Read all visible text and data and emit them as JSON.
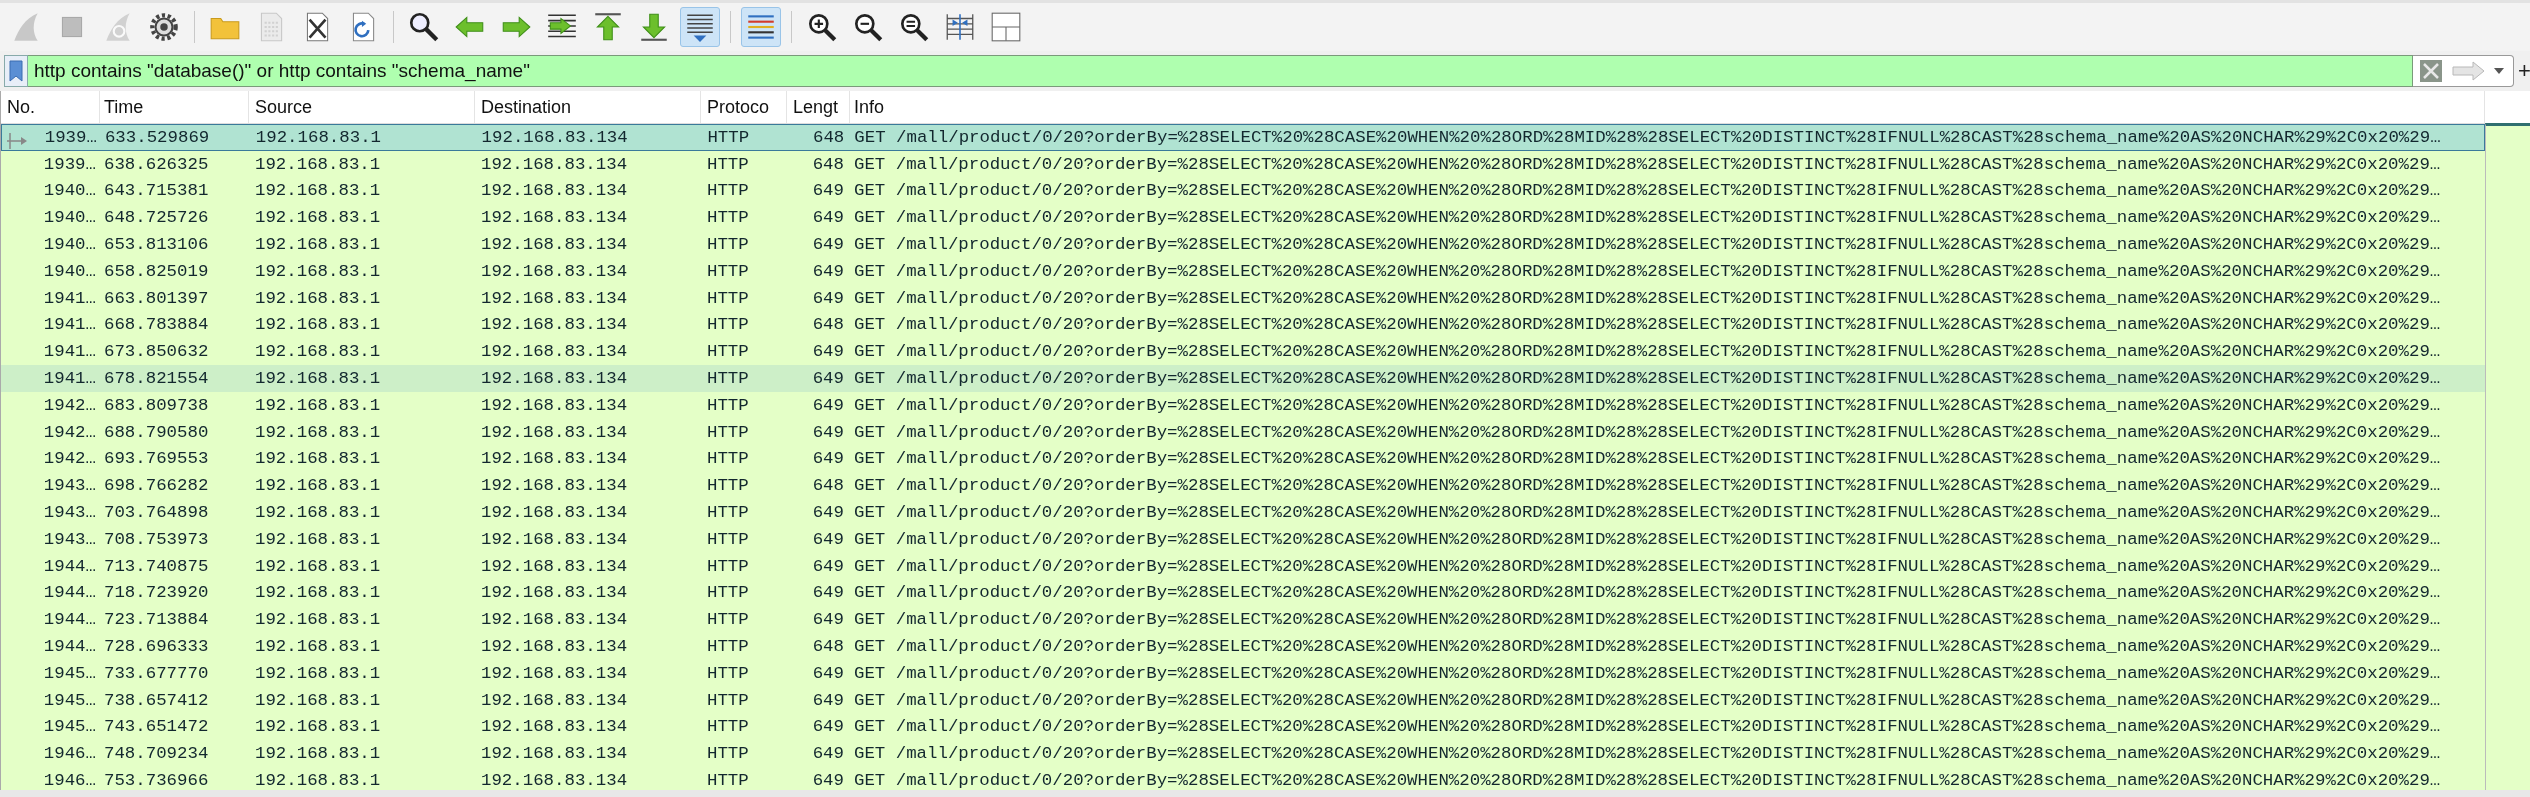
{
  "toolbar": [
    {
      "kind": "start",
      "disabled": true,
      "pressed": false
    },
    {
      "kind": "stop",
      "disabled": true,
      "pressed": false
    },
    {
      "kind": "restart",
      "disabled": true,
      "pressed": false
    },
    {
      "kind": "options",
      "disabled": false,
      "pressed": false
    },
    {
      "kind": "separator"
    },
    {
      "kind": "open",
      "disabled": false,
      "pressed": false
    },
    {
      "kind": "save",
      "disabled": true,
      "pressed": false
    },
    {
      "kind": "close",
      "disabled": false,
      "pressed": false
    },
    {
      "kind": "reload",
      "disabled": false,
      "pressed": false
    },
    {
      "kind": "separator"
    },
    {
      "kind": "find",
      "disabled": false,
      "pressed": false
    },
    {
      "kind": "back",
      "disabled": false,
      "pressed": false
    },
    {
      "kind": "forward",
      "disabled": false,
      "pressed": false
    },
    {
      "kind": "goto",
      "disabled": false,
      "pressed": false
    },
    {
      "kind": "first",
      "disabled": false,
      "pressed": false
    },
    {
      "kind": "last",
      "disabled": false,
      "pressed": false
    },
    {
      "kind": "autoscroll",
      "disabled": false,
      "pressed": true
    },
    {
      "kind": "separator"
    },
    {
      "kind": "colorize",
      "disabled": false,
      "pressed": true
    },
    {
      "kind": "separator"
    },
    {
      "kind": "zoomin",
      "disabled": false,
      "pressed": false
    },
    {
      "kind": "zoomout",
      "disabled": false,
      "pressed": false
    },
    {
      "kind": "zoomreset",
      "disabled": false,
      "pressed": false
    },
    {
      "kind": "resize",
      "disabled": false,
      "pressed": false
    },
    {
      "kind": "layout",
      "disabled": false,
      "pressed": false
    }
  ],
  "filter": {
    "value": "http contains \"database()\" or http contains \"schema_name\"",
    "add_label": "+"
  },
  "table": {
    "columns": [
      "No.",
      "Time",
      "Source",
      "Destination",
      "Protoco",
      "Lengt",
      "Info"
    ],
    "rows": [
      {
        "no": "1939…",
        "time": "633.529869",
        "source": "192.168.83.1",
        "destination": "192.168.83.134",
        "protocol": "HTTP",
        "length": "648",
        "info": "GET /mall/product/0/20?orderBy=%28SELECT%20%28CASE%20WHEN%20%28ORD%28MID%28%28SELECT%20DISTINCT%28IFNULL%28CAST%28schema_name%20AS%20NCHAR%29%2C0x20%29…",
        "selected": true,
        "hovered": false,
        "related": true
      },
      {
        "no": "1939…",
        "time": "638.626325",
        "source": "192.168.83.1",
        "destination": "192.168.83.134",
        "protocol": "HTTP",
        "length": "648",
        "info": "GET /mall/product/0/20?orderBy=%28SELECT%20%28CASE%20WHEN%20%28ORD%28MID%28%28SELECT%20DISTINCT%28IFNULL%28CAST%28schema_name%20AS%20NCHAR%29%2C0x20%29…",
        "selected": false,
        "hovered": false,
        "related": false
      },
      {
        "no": "1940…",
        "time": "643.715381",
        "source": "192.168.83.1",
        "destination": "192.168.83.134",
        "protocol": "HTTP",
        "length": "649",
        "info": "GET /mall/product/0/20?orderBy=%28SELECT%20%28CASE%20WHEN%20%28ORD%28MID%28%28SELECT%20DISTINCT%28IFNULL%28CAST%28schema_name%20AS%20NCHAR%29%2C0x20%29…",
        "selected": false,
        "hovered": false,
        "related": false
      },
      {
        "no": "1940…",
        "time": "648.725726",
        "source": "192.168.83.1",
        "destination": "192.168.83.134",
        "protocol": "HTTP",
        "length": "649",
        "info": "GET /mall/product/0/20?orderBy=%28SELECT%20%28CASE%20WHEN%20%28ORD%28MID%28%28SELECT%20DISTINCT%28IFNULL%28CAST%28schema_name%20AS%20NCHAR%29%2C0x20%29…",
        "selected": false,
        "hovered": false,
        "related": false
      },
      {
        "no": "1940…",
        "time": "653.813106",
        "source": "192.168.83.1",
        "destination": "192.168.83.134",
        "protocol": "HTTP",
        "length": "649",
        "info": "GET /mall/product/0/20?orderBy=%28SELECT%20%28CASE%20WHEN%20%28ORD%28MID%28%28SELECT%20DISTINCT%28IFNULL%28CAST%28schema_name%20AS%20NCHAR%29%2C0x20%29…",
        "selected": false,
        "hovered": false,
        "related": false
      },
      {
        "no": "1940…",
        "time": "658.825019",
        "source": "192.168.83.1",
        "destination": "192.168.83.134",
        "protocol": "HTTP",
        "length": "649",
        "info": "GET /mall/product/0/20?orderBy=%28SELECT%20%28CASE%20WHEN%20%28ORD%28MID%28%28SELECT%20DISTINCT%28IFNULL%28CAST%28schema_name%20AS%20NCHAR%29%2C0x20%29…",
        "selected": false,
        "hovered": false,
        "related": false
      },
      {
        "no": "1941…",
        "time": "663.801397",
        "source": "192.168.83.1",
        "destination": "192.168.83.134",
        "protocol": "HTTP",
        "length": "649",
        "info": "GET /mall/product/0/20?orderBy=%28SELECT%20%28CASE%20WHEN%20%28ORD%28MID%28%28SELECT%20DISTINCT%28IFNULL%28CAST%28schema_name%20AS%20NCHAR%29%2C0x20%29…",
        "selected": false,
        "hovered": false,
        "related": false
      },
      {
        "no": "1941…",
        "time": "668.783884",
        "source": "192.168.83.1",
        "destination": "192.168.83.134",
        "protocol": "HTTP",
        "length": "648",
        "info": "GET /mall/product/0/20?orderBy=%28SELECT%20%28CASE%20WHEN%20%28ORD%28MID%28%28SELECT%20DISTINCT%28IFNULL%28CAST%28schema_name%20AS%20NCHAR%29%2C0x20%29…",
        "selected": false,
        "hovered": false,
        "related": false
      },
      {
        "no": "1941…",
        "time": "673.850632",
        "source": "192.168.83.1",
        "destination": "192.168.83.134",
        "protocol": "HTTP",
        "length": "649",
        "info": "GET /mall/product/0/20?orderBy=%28SELECT%20%28CASE%20WHEN%20%28ORD%28MID%28%28SELECT%20DISTINCT%28IFNULL%28CAST%28schema_name%20AS%20NCHAR%29%2C0x20%29…",
        "selected": false,
        "hovered": false,
        "related": false
      },
      {
        "no": "1941…",
        "time": "678.821554",
        "source": "192.168.83.1",
        "destination": "192.168.83.134",
        "protocol": "HTTP",
        "length": "649",
        "info": "GET /mall/product/0/20?orderBy=%28SELECT%20%28CASE%20WHEN%20%28ORD%28MID%28%28SELECT%20DISTINCT%28IFNULL%28CAST%28schema_name%20AS%20NCHAR%29%2C0x20%29…",
        "selected": false,
        "hovered": true,
        "related": false
      },
      {
        "no": "1942…",
        "time": "683.809738",
        "source": "192.168.83.1",
        "destination": "192.168.83.134",
        "protocol": "HTTP",
        "length": "649",
        "info": "GET /mall/product/0/20?orderBy=%28SELECT%20%28CASE%20WHEN%20%28ORD%28MID%28%28SELECT%20DISTINCT%28IFNULL%28CAST%28schema_name%20AS%20NCHAR%29%2C0x20%29…",
        "selected": false,
        "hovered": false,
        "related": false
      },
      {
        "no": "1942…",
        "time": "688.790580",
        "source": "192.168.83.1",
        "destination": "192.168.83.134",
        "protocol": "HTTP",
        "length": "649",
        "info": "GET /mall/product/0/20?orderBy=%28SELECT%20%28CASE%20WHEN%20%28ORD%28MID%28%28SELECT%20DISTINCT%28IFNULL%28CAST%28schema_name%20AS%20NCHAR%29%2C0x20%29…",
        "selected": false,
        "hovered": false,
        "related": false
      },
      {
        "no": "1942…",
        "time": "693.769553",
        "source": "192.168.83.1",
        "destination": "192.168.83.134",
        "protocol": "HTTP",
        "length": "649",
        "info": "GET /mall/product/0/20?orderBy=%28SELECT%20%28CASE%20WHEN%20%28ORD%28MID%28%28SELECT%20DISTINCT%28IFNULL%28CAST%28schema_name%20AS%20NCHAR%29%2C0x20%29…",
        "selected": false,
        "hovered": false,
        "related": false
      },
      {
        "no": "1943…",
        "time": "698.766282",
        "source": "192.168.83.1",
        "destination": "192.168.83.134",
        "protocol": "HTTP",
        "length": "648",
        "info": "GET /mall/product/0/20?orderBy=%28SELECT%20%28CASE%20WHEN%20%28ORD%28MID%28%28SELECT%20DISTINCT%28IFNULL%28CAST%28schema_name%20AS%20NCHAR%29%2C0x20%29…",
        "selected": false,
        "hovered": false,
        "related": false
      },
      {
        "no": "1943…",
        "time": "703.764898",
        "source": "192.168.83.1",
        "destination": "192.168.83.134",
        "protocol": "HTTP",
        "length": "649",
        "info": "GET /mall/product/0/20?orderBy=%28SELECT%20%28CASE%20WHEN%20%28ORD%28MID%28%28SELECT%20DISTINCT%28IFNULL%28CAST%28schema_name%20AS%20NCHAR%29%2C0x20%29…",
        "selected": false,
        "hovered": false,
        "related": false
      },
      {
        "no": "1943…",
        "time": "708.753973",
        "source": "192.168.83.1",
        "destination": "192.168.83.134",
        "protocol": "HTTP",
        "length": "649",
        "info": "GET /mall/product/0/20?orderBy=%28SELECT%20%28CASE%20WHEN%20%28ORD%28MID%28%28SELECT%20DISTINCT%28IFNULL%28CAST%28schema_name%20AS%20NCHAR%29%2C0x20%29…",
        "selected": false,
        "hovered": false,
        "related": false
      },
      {
        "no": "1944…",
        "time": "713.740875",
        "source": "192.168.83.1",
        "destination": "192.168.83.134",
        "protocol": "HTTP",
        "length": "649",
        "info": "GET /mall/product/0/20?orderBy=%28SELECT%20%28CASE%20WHEN%20%28ORD%28MID%28%28SELECT%20DISTINCT%28IFNULL%28CAST%28schema_name%20AS%20NCHAR%29%2C0x20%29…",
        "selected": false,
        "hovered": false,
        "related": false
      },
      {
        "no": "1944…",
        "time": "718.723920",
        "source": "192.168.83.1",
        "destination": "192.168.83.134",
        "protocol": "HTTP",
        "length": "649",
        "info": "GET /mall/product/0/20?orderBy=%28SELECT%20%28CASE%20WHEN%20%28ORD%28MID%28%28SELECT%20DISTINCT%28IFNULL%28CAST%28schema_name%20AS%20NCHAR%29%2C0x20%29…",
        "selected": false,
        "hovered": false,
        "related": false
      },
      {
        "no": "1944…",
        "time": "723.713884",
        "source": "192.168.83.1",
        "destination": "192.168.83.134",
        "protocol": "HTTP",
        "length": "649",
        "info": "GET /mall/product/0/20?orderBy=%28SELECT%20%28CASE%20WHEN%20%28ORD%28MID%28%28SELECT%20DISTINCT%28IFNULL%28CAST%28schema_name%20AS%20NCHAR%29%2C0x20%29…",
        "selected": false,
        "hovered": false,
        "related": false
      },
      {
        "no": "1944…",
        "time": "728.696333",
        "source": "192.168.83.1",
        "destination": "192.168.83.134",
        "protocol": "HTTP",
        "length": "648",
        "info": "GET /mall/product/0/20?orderBy=%28SELECT%20%28CASE%20WHEN%20%28ORD%28MID%28%28SELECT%20DISTINCT%28IFNULL%28CAST%28schema_name%20AS%20NCHAR%29%2C0x20%29…",
        "selected": false,
        "hovered": false,
        "related": false
      },
      {
        "no": "1945…",
        "time": "733.677770",
        "source": "192.168.83.1",
        "destination": "192.168.83.134",
        "protocol": "HTTP",
        "length": "649",
        "info": "GET /mall/product/0/20?orderBy=%28SELECT%20%28CASE%20WHEN%20%28ORD%28MID%28%28SELECT%20DISTINCT%28IFNULL%28CAST%28schema_name%20AS%20NCHAR%29%2C0x20%29…",
        "selected": false,
        "hovered": false,
        "related": false
      },
      {
        "no": "1945…",
        "time": "738.657412",
        "source": "192.168.83.1",
        "destination": "192.168.83.134",
        "protocol": "HTTP",
        "length": "649",
        "info": "GET /mall/product/0/20?orderBy=%28SELECT%20%28CASE%20WHEN%20%28ORD%28MID%28%28SELECT%20DISTINCT%28IFNULL%28CAST%28schema_name%20AS%20NCHAR%29%2C0x20%29…",
        "selected": false,
        "hovered": false,
        "related": false
      },
      {
        "no": "1945…",
        "time": "743.651472",
        "source": "192.168.83.1",
        "destination": "192.168.83.134",
        "protocol": "HTTP",
        "length": "649",
        "info": "GET /mall/product/0/20?orderBy=%28SELECT%20%28CASE%20WHEN%20%28ORD%28MID%28%28SELECT%20DISTINCT%28IFNULL%28CAST%28schema_name%20AS%20NCHAR%29%2C0x20%29…",
        "selected": false,
        "hovered": false,
        "related": false
      },
      {
        "no": "1946…",
        "time": "748.709234",
        "source": "192.168.83.1",
        "destination": "192.168.83.134",
        "protocol": "HTTP",
        "length": "649",
        "info": "GET /mall/product/0/20?orderBy=%28SELECT%20%28CASE%20WHEN%20%28ORD%28MID%28%28SELECT%20DISTINCT%28IFNULL%28CAST%28schema_name%20AS%20NCHAR%29%2C0x20%29…",
        "selected": false,
        "hovered": false,
        "related": false
      },
      {
        "no": "1946…",
        "time": "753.736966",
        "source": "192.168.83.1",
        "destination": "192.168.83.134",
        "protocol": "HTTP",
        "length": "649",
        "info": "GET /mall/product/0/20?orderBy=%28SELECT%20%28CASE%20WHEN%20%28ORD%28MID%28%28SELECT%20DISTINCT%28IFNULL%28CAST%28schema_name%20AS%20NCHAR%29%2C0x20%29…",
        "selected": false,
        "hovered": false,
        "related": false
      }
    ]
  }
}
